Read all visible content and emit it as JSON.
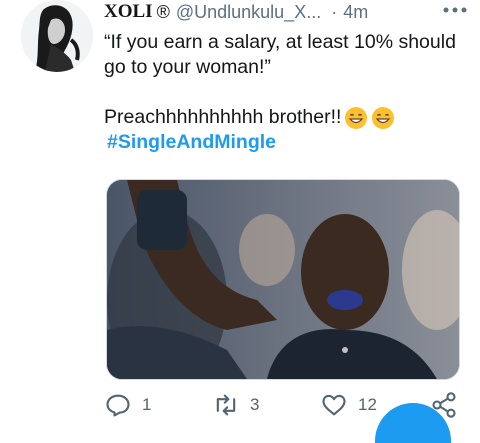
{
  "tweet": {
    "author_name": "XOLI",
    "registered_mark": "®",
    "handle": "@Undlunkulu_X...",
    "separator": "·",
    "time": "4m",
    "text_line1": "“If you earn a salary, at least 10% should go to your woman!”",
    "text_line2": "Preachhhhhhhhhh brother!!",
    "hashtag": "#SingleAndMingle"
  },
  "actions": {
    "reply_count": "1",
    "retweet_count": "3",
    "like_count": "12"
  },
  "icons": {
    "more": "more-horizontal-icon",
    "reply": "reply-icon",
    "retweet": "retweet-icon",
    "like": "heart-icon",
    "share": "share-icon",
    "emoji": "grinning-face-emoji"
  },
  "colors": {
    "hashtag": "#1d9bf0",
    "secondary_text": "#5b7083",
    "fab": "#1d9bf0"
  }
}
